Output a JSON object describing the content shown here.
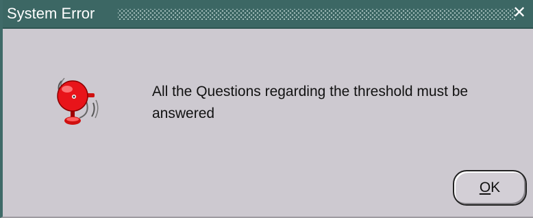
{
  "window": {
    "title": "System Error",
    "close_glyph": "✕"
  },
  "dialog": {
    "icon": "alarm-bell-icon",
    "message": "All the Questions regarding the threshold must be answered"
  },
  "buttons": {
    "ok_mnemonic": "O",
    "ok_rest": "K"
  },
  "colors": {
    "titlebar": "#3c6764",
    "dialog_background": "#cdc9d0",
    "bell_red": "#e8141a"
  }
}
